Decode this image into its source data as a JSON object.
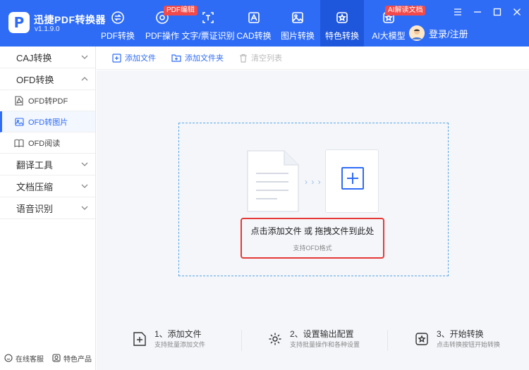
{
  "app": {
    "logo_letter": "P",
    "name": "迅捷PDF转换器",
    "version": "v1.1.9.0"
  },
  "nav": [
    {
      "label": "PDF转换",
      "icon": "pdf-convert-icon"
    },
    {
      "label": "PDF操作",
      "icon": "pdf-operate-icon",
      "badge": "PDF编辑"
    },
    {
      "label": "文字/票证识别",
      "icon": "ocr-icon"
    },
    {
      "label": "CAD转换",
      "icon": "cad-icon"
    },
    {
      "label": "图片转换",
      "icon": "image-convert-icon"
    },
    {
      "label": "特色转换",
      "icon": "special-convert-icon"
    },
    {
      "label": "AI大模型",
      "icon": "ai-model-icon",
      "badge": "AI解读文档"
    }
  ],
  "login": {
    "label": "登录/注册"
  },
  "sidebar": {
    "groups": [
      {
        "label": "CAJ转换"
      },
      {
        "label": "OFD转换"
      },
      {
        "label": "翻译工具"
      },
      {
        "label": "文档压缩"
      },
      {
        "label": "语音识别"
      }
    ],
    "subitems": [
      {
        "label": "OFD转PDF"
      },
      {
        "label": "OFD转图片"
      },
      {
        "label": "OFD阅读"
      }
    ],
    "footer": {
      "service": "在线客服",
      "featured": "特色产品"
    }
  },
  "toolbar": {
    "add_file": "添加文件",
    "add_folder": "添加文件夹",
    "clear_list": "清空列表"
  },
  "dropzone": {
    "arrows": "› › ›",
    "main_hint": "点击添加文件 或 拖拽文件到此处",
    "sub_hint": "支持OFD格式"
  },
  "steps": [
    {
      "title": "1、添加文件",
      "desc": "支持批量添加文件"
    },
    {
      "title": "2、设置输出配置",
      "desc": "支持批量操作和各种设置"
    },
    {
      "title": "3、开始转换",
      "desc": "点击转换按钮开始转换"
    }
  ],
  "colors": {
    "brand": "#2f6cf6",
    "active_nav": "#1f57dc",
    "badge": "#f24a4a",
    "highlight": "#e53935"
  }
}
